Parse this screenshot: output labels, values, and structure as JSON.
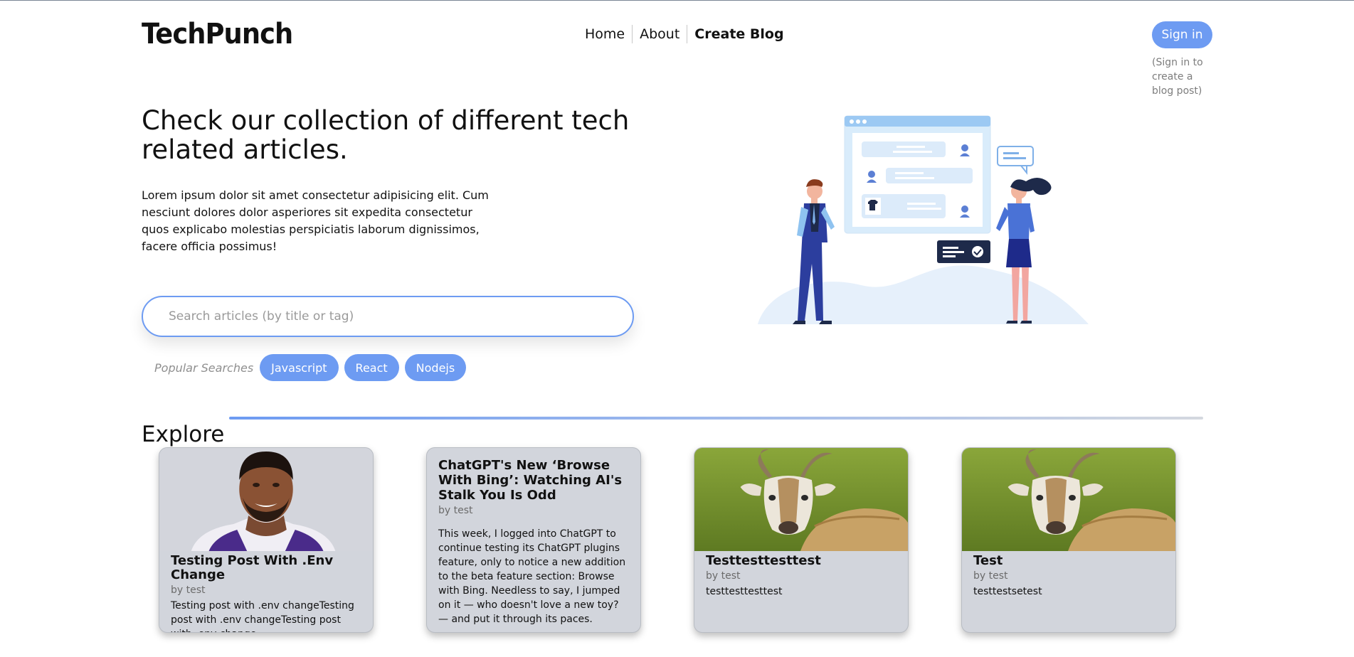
{
  "header": {
    "logo": "TechPunch",
    "nav": [
      "Home",
      "About",
      "Create Blog"
    ],
    "signin_label": "Sign in",
    "signin_note": "(Sign in to create a blog post)"
  },
  "hero": {
    "title": "Check our collection of different tech related articles.",
    "description": "Lorem ipsum dolor sit amet consectetur adipisicing elit. Cum nesciunt dolores dolor asperiores sit expedita consectetur quos explicabo molestias perspiciatis laborum dignissimos, facere officia possimus!",
    "search_placeholder": "Search articles (by title or tag)",
    "popular_label": "Popular Searches",
    "popular_tags": [
      "Javascript",
      "React",
      "Nodejs"
    ]
  },
  "explore": {
    "heading": "Explore",
    "cards": [
      {
        "title": "Testing Post With .Env Change",
        "author": "by test",
        "excerpt": "Testing post with .env changeTesting post with .env changeTesting post with .env change",
        "image": "portrait"
      },
      {
        "title": "ChatGPT's New ‘Browse With Bing’: Watching AI's Stalk You Is Odd",
        "author": "by test",
        "excerpt": "This week, I logged into ChatGPT to continue testing its ChatGPT plugins feature, only to notice a new addition to the beta feature section: Browse with Bing. Needless to say, I jumped on it — who doesn't love a new toy? — and put it through its paces.",
        "image": "none"
      },
      {
        "title": "Testtesttesttest",
        "author": "by test",
        "excerpt": "testtesttesttest",
        "image": "goat"
      },
      {
        "title": "Test",
        "author": "by test",
        "excerpt": "testtestsetest",
        "image": "goat"
      }
    ]
  },
  "colors": {
    "accent": "#6d9bf2",
    "card_bg": "#d2d5dc"
  }
}
